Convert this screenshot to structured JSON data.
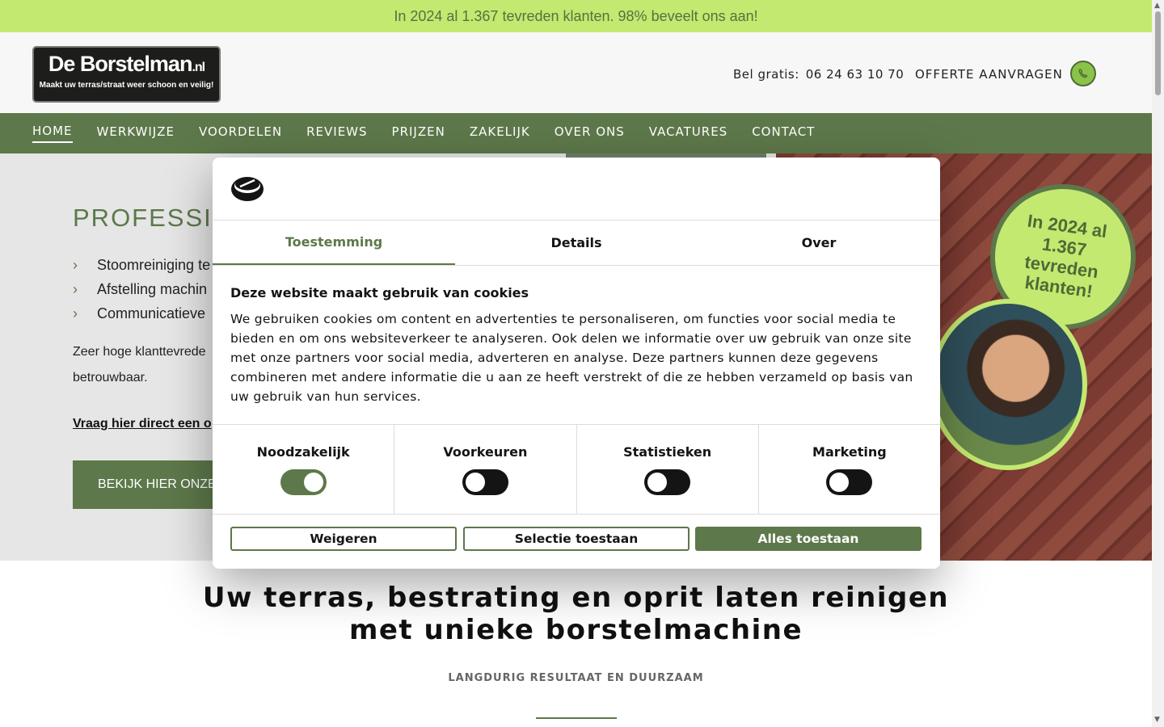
{
  "promo": {
    "text": "In 2024 al 1.367 tevreden klanten. 98% beveelt ons aan!"
  },
  "header": {
    "logo_main": "De Borstelman",
    "logo_tld": ".nl",
    "logo_tagline": "Maakt uw terras/straat weer schoon en veilig!",
    "call_label": "Bel gratis:",
    "phone": "06 24 63 10 70",
    "quote_link": "OFFERTE AANVRAGEN",
    "whatsapp_icon": "whatsapp-icon"
  },
  "nav": {
    "items": [
      {
        "label": "HOME",
        "active": true
      },
      {
        "label": "WERKWIJZE"
      },
      {
        "label": "VOORDELEN"
      },
      {
        "label": "REVIEWS"
      },
      {
        "label": "PRIJZEN"
      },
      {
        "label": "ZAKELIJK"
      },
      {
        "label": "OVER ONS"
      },
      {
        "label": "VACATURES"
      },
      {
        "label": "CONTACT"
      }
    ]
  },
  "hero": {
    "title": "PROFESSIONE",
    "list": [
      "Stoomreiniging te",
      "Afstelling machin",
      "Communicatieve"
    ],
    "text": "Zeer hoge klanttevrede betrouwbaar.",
    "link": "Vraag hier direct een o",
    "button": "BEKIJK HIER ONZE",
    "badge": [
      "In 2024 al",
      "1.367",
      "tevreden",
      "klanten!"
    ]
  },
  "section": {
    "title_line1": "Uw terras, bestrating en oprit laten reinigen",
    "title_line2": "met unieke borstelmachine",
    "subtitle": "LANGDURIG RESULTAAT EN DUURZAAM"
  },
  "cookie_dialog": {
    "tabs": [
      {
        "label": "Toestemming",
        "active": true
      },
      {
        "label": "Details"
      },
      {
        "label": "Over"
      }
    ],
    "heading": "Deze website maakt gebruik van cookies",
    "body": "We gebruiken cookies om content en advertenties te personaliseren, om functies voor social media te bieden en om ons websiteverkeer te analyseren. Ook delen we informatie over uw gebruik van onze site met onze partners voor social media, adverteren en analyse. Deze partners kunnen deze gegevens combineren met andere informatie die u aan ze heeft verstrekt of die ze hebben verzameld op basis van uw gebruik van hun services.",
    "categories": [
      {
        "label": "Noodzakelijk",
        "enabled": true
      },
      {
        "label": "Voorkeuren",
        "enabled": false
      },
      {
        "label": "Statistieken",
        "enabled": false
      },
      {
        "label": "Marketing",
        "enabled": false
      }
    ],
    "buttons": {
      "deny": "Weigeren",
      "allow_selection": "Selectie toestaan",
      "allow_all": "Alles toestaan"
    }
  },
  "colors": {
    "brand_green": "#5d784a",
    "lime": "#c3e970",
    "dark": "#141414"
  }
}
